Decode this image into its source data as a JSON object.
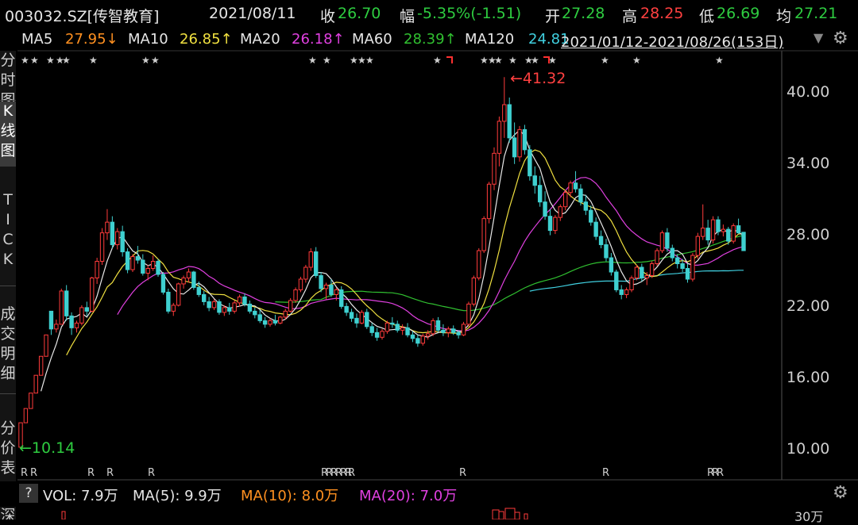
{
  "header": {
    "code": "003032.SZ[传智教育]",
    "date": "2021/08/11",
    "close_label": "收",
    "close": "26.70",
    "change_label": "幅",
    "change": "-5.35%(-1.51)",
    "open_label": "开",
    "open": "27.28",
    "high_label": "高",
    "high": "28.25",
    "low_label": "低",
    "low": "26.69",
    "avg_label": "均",
    "avg": "27.21"
  },
  "ma_row": {
    "ma5_label": "MA5",
    "ma5": "27.95↓",
    "ma10_label": "MA10",
    "ma10": "26.85↑",
    "ma20_label": "MA20",
    "ma20": "26.18↑",
    "ma60_label": "MA60",
    "ma60": "28.39↑",
    "ma120_label": "MA120",
    "ma120": "24.81",
    "range": "2021/01/12-2021/08/26(153日)"
  },
  "sidebar": {
    "tabs": [
      {
        "label": "分时图",
        "active": false
      },
      {
        "label": "K线图",
        "active": true
      },
      {
        "label": "TICK",
        "active": false
      },
      {
        "label": "成交明细",
        "active": false
      },
      {
        "label": "分价表",
        "active": false
      },
      {
        "label": "深",
        "active": false
      }
    ]
  },
  "annotations": {
    "high_marker": "41.32",
    "low_marker": "10.14",
    "star": "★",
    "r": "R"
  },
  "volume": {
    "help": "?",
    "vol_label": "VOL: 7.9万",
    "ma5": "MA(5): 9.9万",
    "ma10": "MA(10): 8.0万",
    "ma20": "MA(20): 7.0万",
    "top_tick": "30万"
  },
  "colors": {
    "up": "#ff3b3b",
    "down": "#3fd0d0",
    "ma5": "#e8e8e8",
    "ma10": "#f0e040",
    "ma20": "#e040e0",
    "ma60": "#30c030",
    "ma120": "#40d0e0",
    "green_text": "#2ecc40",
    "red_text": "#ff4040",
    "orange_text": "#ff9020"
  },
  "chart_data": {
    "type": "candlestick",
    "y_ticks": [
      "40.00",
      "34.00",
      "28.00",
      "22.00",
      "16.00",
      "10.00"
    ],
    "ylim": [
      8.9,
      42.3
    ],
    "ma5_last": 27.95,
    "ma10_last": 26.85,
    "ma20_last": 26.18,
    "ma60_last": 28.39,
    "ma120_last": 24.81,
    "candles": [
      [
        10.14,
        12.2,
        10.14,
        12.2
      ],
      [
        12.2,
        13.4,
        12.2,
        13.4
      ],
      [
        13.4,
        14.7,
        13.4,
        14.7
      ],
      [
        14.7,
        16.2,
        14.7,
        16.2
      ],
      [
        16.2,
        17.8,
        16.2,
        17.8
      ],
      [
        17.8,
        19.6,
        17.8,
        19.6
      ],
      [
        21.6,
        21.6,
        19.6,
        20.1
      ],
      [
        20.1,
        20.9,
        19.8,
        20.5
      ],
      [
        20.5,
        23.5,
        20.5,
        23.3
      ],
      [
        23.3,
        23.8,
        20.8,
        21.2
      ],
      [
        21.2,
        21.5,
        19.6,
        20.2
      ],
      [
        20.2,
        20.8,
        19.8,
        20.6
      ],
      [
        20.6,
        22.1,
        20.4,
        21.9
      ],
      [
        21.9,
        22.4,
        21.2,
        21.6
      ],
      [
        21.6,
        24.5,
        21.5,
        24.4
      ],
      [
        24.4,
        26.1,
        23.9,
        25.8
      ],
      [
        25.8,
        28.6,
        25.5,
        28.2
      ],
      [
        28.2,
        30.2,
        27.6,
        29.1
      ],
      [
        29.1,
        29.6,
        26.9,
        27.2
      ],
      [
        27.2,
        28.6,
        26.8,
        28.3
      ],
      [
        28.3,
        28.8,
        26.2,
        26.6
      ],
      [
        26.6,
        26.9,
        24.8,
        25.1
      ],
      [
        25.1,
        26.4,
        24.9,
        26.2
      ],
      [
        26.2,
        27.1,
        25.6,
        25.9
      ],
      [
        25.9,
        26.4,
        24.6,
        24.8
      ],
      [
        24.8,
        25.5,
        24.2,
        25.2
      ],
      [
        25.2,
        26.3,
        25.0,
        25.8
      ],
      [
        25.8,
        26.0,
        24.5,
        24.7
      ],
      [
        24.7,
        24.9,
        23.0,
        23.2
      ],
      [
        23.2,
        23.5,
        21.4,
        21.6
      ],
      [
        21.6,
        22.3,
        21.2,
        22.1
      ],
      [
        22.1,
        24.0,
        22.0,
        23.9
      ],
      [
        23.9,
        24.6,
        23.5,
        24.4
      ],
      [
        24.4,
        25.2,
        24.0,
        24.9
      ],
      [
        24.9,
        25.0,
        23.4,
        23.6
      ],
      [
        23.6,
        24.1,
        22.8,
        23.0
      ],
      [
        23.0,
        23.3,
        22.1,
        22.4
      ],
      [
        22.4,
        22.8,
        21.6,
        21.9
      ],
      [
        21.9,
        22.6,
        21.7,
        22.4
      ],
      [
        22.4,
        22.6,
        21.3,
        21.5
      ],
      [
        21.5,
        22.1,
        21.2,
        21.9
      ],
      [
        21.9,
        22.3,
        21.3,
        21.6
      ],
      [
        21.6,
        22.5,
        21.4,
        22.3
      ],
      [
        22.3,
        23.0,
        22.0,
        22.8
      ],
      [
        22.8,
        23.1,
        22.0,
        22.2
      ],
      [
        22.2,
        22.5,
        21.4,
        21.6
      ],
      [
        21.6,
        21.9,
        21.0,
        21.3
      ],
      [
        21.3,
        21.7,
        20.6,
        20.8
      ],
      [
        20.8,
        21.1,
        20.2,
        20.5
      ],
      [
        20.5,
        21.0,
        20.3,
        20.8
      ],
      [
        20.8,
        21.3,
        20.4,
        20.6
      ],
      [
        20.6,
        21.2,
        20.5,
        21.1
      ],
      [
        21.1,
        21.8,
        20.9,
        21.6
      ],
      [
        21.6,
        22.7,
        21.5,
        22.5
      ],
      [
        22.5,
        23.6,
        22.3,
        23.4
      ],
      [
        23.4,
        24.5,
        23.2,
        24.3
      ],
      [
        24.3,
        25.5,
        24.0,
        25.3
      ],
      [
        25.3,
        26.9,
        25.0,
        26.6
      ],
      [
        26.6,
        27.0,
        24.4,
        24.6
      ],
      [
        24.6,
        24.9,
        23.2,
        23.5
      ],
      [
        23.5,
        24.0,
        22.6,
        23.8
      ],
      [
        23.8,
        24.3,
        22.8,
        23.0
      ],
      [
        23.0,
        23.6,
        22.5,
        23.4
      ],
      [
        23.4,
        23.7,
        21.8,
        22.0
      ],
      [
        22.0,
        22.3,
        21.2,
        21.5
      ],
      [
        21.5,
        21.8,
        20.7,
        21.0
      ],
      [
        21.0,
        21.4,
        20.2,
        20.6
      ],
      [
        20.6,
        21.7,
        20.5,
        21.5
      ],
      [
        21.5,
        21.8,
        20.1,
        20.3
      ],
      [
        20.3,
        20.6,
        19.5,
        19.8
      ],
      [
        19.8,
        20.2,
        19.1,
        19.4
      ],
      [
        19.4,
        20.1,
        19.2,
        19.9
      ],
      [
        19.9,
        20.8,
        19.7,
        20.6
      ],
      [
        20.6,
        21.1,
        20.2,
        20.5
      ],
      [
        20.5,
        20.8,
        19.8,
        20.0
      ],
      [
        20.0,
        20.5,
        19.6,
        20.2
      ],
      [
        20.2,
        20.6,
        19.4,
        19.6
      ],
      [
        19.6,
        19.9,
        19.0,
        19.3
      ],
      [
        19.3,
        19.6,
        18.6,
        18.9
      ],
      [
        18.9,
        19.7,
        18.7,
        19.5
      ],
      [
        19.5,
        20.0,
        19.2,
        19.7
      ],
      [
        19.7,
        21.0,
        19.5,
        20.8
      ],
      [
        20.8,
        21.1,
        19.8,
        20.0
      ],
      [
        20.0,
        20.5,
        19.5,
        19.8
      ],
      [
        19.8,
        20.3,
        19.4,
        20.1
      ],
      [
        20.1,
        20.4,
        19.6,
        19.8
      ],
      [
        19.8,
        20.0,
        19.3,
        19.6
      ],
      [
        19.6,
        20.7,
        19.5,
        20.5
      ],
      [
        20.5,
        22.4,
        20.3,
        22.2
      ],
      [
        22.2,
        24.6,
        22.0,
        24.4
      ],
      [
        24.4,
        26.9,
        24.2,
        26.7
      ],
      [
        26.7,
        29.6,
        26.5,
        29.4
      ],
      [
        29.4,
        32.5,
        29.0,
        32.3
      ],
      [
        32.3,
        35.4,
        31.8,
        34.9
      ],
      [
        34.9,
        38.0,
        33.8,
        37.6
      ],
      [
        37.6,
        41.32,
        36.2,
        39.0
      ],
      [
        39.0,
        39.6,
        35.8,
        36.2
      ],
      [
        36.2,
        37.5,
        34.0,
        34.6
      ],
      [
        34.6,
        37.2,
        34.2,
        36.9
      ],
      [
        36.9,
        37.3,
        34.8,
        35.2
      ],
      [
        35.2,
        35.6,
        32.6,
        33.0
      ],
      [
        33.0,
        33.8,
        31.5,
        32.2
      ],
      [
        32.2,
        33.0,
        30.4,
        30.8
      ],
      [
        30.8,
        31.7,
        29.3,
        29.6
      ],
      [
        29.6,
        30.2,
        28.0,
        28.4
      ],
      [
        28.4,
        29.7,
        28.1,
        29.5
      ],
      [
        29.5,
        30.6,
        29.2,
        30.4
      ],
      [
        30.4,
        31.8,
        30.1,
        31.6
      ],
      [
        31.6,
        32.6,
        31.2,
        32.4
      ],
      [
        32.4,
        33.4,
        31.6,
        31.9
      ],
      [
        31.9,
        32.3,
        30.5,
        30.8
      ],
      [
        30.8,
        31.4,
        29.7,
        30.1
      ],
      [
        30.1,
        30.5,
        28.8,
        29.1
      ],
      [
        29.1,
        29.5,
        27.6,
        27.9
      ],
      [
        27.9,
        28.4,
        26.9,
        27.2
      ],
      [
        27.2,
        27.7,
        25.8,
        26.1
      ],
      [
        26.1,
        26.5,
        24.6,
        24.9
      ],
      [
        24.9,
        25.1,
        23.2,
        23.4
      ],
      [
        23.4,
        23.8,
        22.6,
        23.0
      ],
      [
        23.0,
        23.6,
        22.7,
        23.4
      ],
      [
        23.4,
        24.6,
        23.2,
        24.4
      ],
      [
        24.4,
        25.5,
        24.2,
        25.3
      ],
      [
        25.3,
        25.6,
        24.1,
        24.4
      ],
      [
        24.4,
        24.9,
        23.8,
        24.6
      ],
      [
        24.6,
        25.8,
        24.4,
        25.6
      ],
      [
        25.6,
        26.9,
        25.4,
        26.7
      ],
      [
        26.7,
        28.4,
        26.5,
        28.2
      ],
      [
        28.2,
        28.6,
        26.6,
        26.9
      ],
      [
        26.9,
        27.2,
        25.8,
        26.1
      ],
      [
        26.1,
        26.4,
        25.2,
        25.6
      ],
      [
        25.6,
        26.0,
        24.9,
        25.2
      ],
      [
        25.2,
        25.6,
        24.0,
        24.3
      ],
      [
        24.3,
        26.5,
        24.1,
        26.3
      ],
      [
        26.3,
        28.2,
        26.0,
        27.9
      ],
      [
        27.9,
        30.6,
        27.6,
        28.6
      ],
      [
        28.6,
        29.3,
        27.2,
        27.6
      ],
      [
        27.6,
        29.6,
        27.3,
        29.3
      ],
      [
        29.3,
        29.6,
        28.0,
        28.3
      ],
      [
        28.3,
        28.9,
        27.9,
        28.5
      ],
      [
        28.5,
        28.7,
        27.2,
        27.5
      ],
      [
        27.5,
        29.0,
        27.3,
        28.8
      ],
      [
        28.8,
        29.4,
        28.1,
        28.2
      ],
      [
        28.25,
        28.25,
        26.69,
        26.7
      ]
    ]
  }
}
